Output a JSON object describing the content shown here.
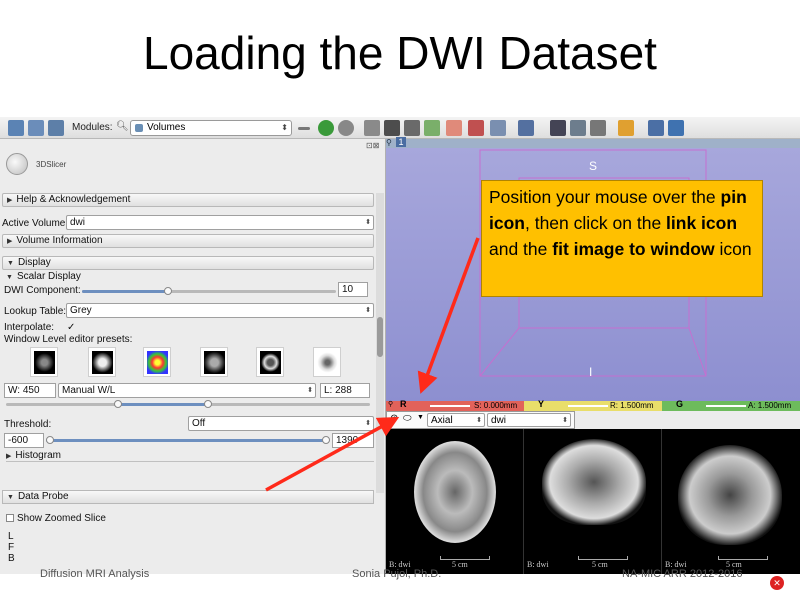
{
  "slide": {
    "title": "Loading the DWI Dataset",
    "footer_left": "Diffusion MRI Analysis",
    "footer_center": "Sonia Pujol, Ph.D.",
    "footer_right": "NA-MIC ARR 2012-2016"
  },
  "toolbar": {
    "modules_label": "Modules:",
    "module_selected": "Volumes",
    "view_number": "1"
  },
  "panel": {
    "logo_text": "3DSlicer",
    "help_section": "Help & Acknowledgement",
    "active_volume_label": "Active Volume",
    "active_volume_value": "dwi",
    "volume_info_section": "Volume Information",
    "display_section": "Display",
    "scalar_display_section": "Scalar Display",
    "dwi_component_label": "DWI Component:",
    "dwi_component_value": "10",
    "dwi_component_fraction": 0.34,
    "lookup_table_label": "Lookup Table:",
    "lookup_table_value": "Grey",
    "interpolate_label": "Interpolate:",
    "interpolate_checked": "✓",
    "window_level_presets_label": "Window Level editor presets:",
    "window_label": "W: 450",
    "window_mode": "Manual W/L",
    "level_label": "L: 288",
    "threshold_label": "Threshold:",
    "threshold_value": "Off",
    "threshold_min": "-600",
    "threshold_max": "1390",
    "histogram_section": "Histogram",
    "data_probe_section": "Data Probe",
    "show_zoomed_slice_label": "Show Zoomed Slice",
    "probe_lines": [
      "L",
      "F",
      "B"
    ]
  },
  "view3d": {
    "orientation_top": "S",
    "orientation_bottom": "I"
  },
  "callout": {
    "part1": "Position your mouse over the ",
    "pin": "pin icon",
    "part2": ", then click on the ",
    "link": "link icon",
    "part3": " and the ",
    "fit": "fit image to window",
    "part4": " icon"
  },
  "slice_bar": {
    "red_label": "R",
    "red_offset": "S: 0.000mm",
    "yellow_label": "Y",
    "yellow_offset": "R: 1.500mm",
    "green_label": "G",
    "green_offset": "A: 1.500mm"
  },
  "slice_controller": {
    "orientation": "Axial",
    "volume": "dwi"
  },
  "slice_views": [
    {
      "label": "B: dwi",
      "scale": "5 cm"
    },
    {
      "label": "B: dwi",
      "scale": "5 cm"
    },
    {
      "label": "B: dwi",
      "scale": "5 cm"
    }
  ],
  "colors": {
    "callout_bg": "#ffc000",
    "arrow": "#ff2a1a",
    "red_slice": "#e2625a",
    "yellow_slice": "#e9de6a",
    "green_slice": "#6dbb5c",
    "view3d_bg": "#9a9cd6"
  }
}
